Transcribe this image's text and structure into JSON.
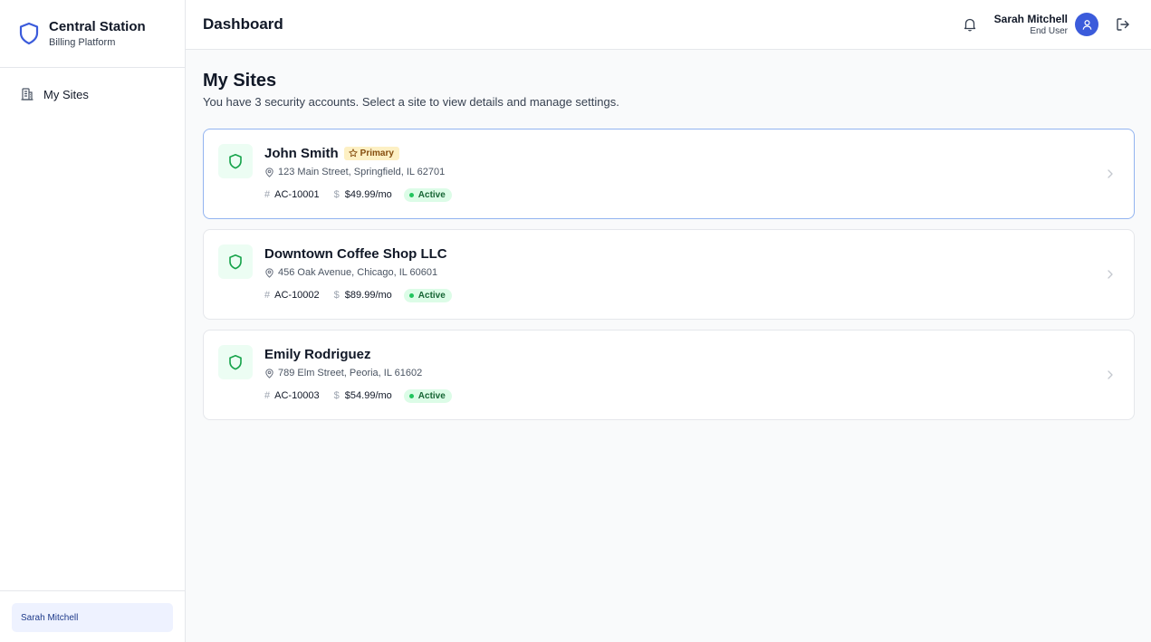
{
  "brand": {
    "title": "Central Station",
    "subtitle": "Billing Platform",
    "icon": "shield-icon"
  },
  "sidebar": {
    "items": [
      {
        "label": "My Sites",
        "icon": "building-icon"
      }
    ],
    "footer_user": "Sarah Mitchell"
  },
  "header": {
    "title": "Dashboard",
    "user_name": "Sarah Mitchell",
    "user_role": "End User"
  },
  "page": {
    "title": "My Sites",
    "subtitle": "You have 3 security accounts. Select a site to view details and manage settings."
  },
  "sites": [
    {
      "name": "John Smith",
      "badge": "Primary",
      "address": "123 Main Street, Springfield, IL 62701",
      "account": "AC-10001",
      "price": "$49.99/mo",
      "status": "Active"
    },
    {
      "name": "Downtown Coffee Shop LLC",
      "address": "456 Oak Avenue, Chicago, IL 60601",
      "account": "AC-10002",
      "price": "$89.99/mo",
      "status": "Active"
    },
    {
      "name": "Emily Rodriguez",
      "address": "789 Elm Street, Peoria, IL 61602",
      "account": "AC-10003",
      "price": "$54.99/mo",
      "status": "Active"
    }
  ],
  "colors": {
    "accent": "#3b5bdb",
    "success": "#22c55e",
    "primary_badge_bg": "#fdf0c4"
  }
}
